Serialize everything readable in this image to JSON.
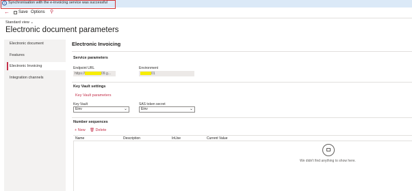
{
  "notification": {
    "message": "Synchronisation with the e-invoicing service was successful"
  },
  "toolbar": {
    "save_label": "Save",
    "options_label": "Options"
  },
  "page": {
    "view_label": "Standard view",
    "title": "Electronic document parameters"
  },
  "nav": {
    "items": [
      {
        "label": "Electronic document"
      },
      {
        "label": "Features"
      },
      {
        "label": "Electronic Invoicing",
        "active": true
      },
      {
        "label": "Integration channels"
      }
    ]
  },
  "content": {
    "title": "Electronic Invoicing",
    "service_parameters": {
      "heading": "Service parameters",
      "endpoint_label": "Endpoint URL",
      "endpoint_prefix": "https://",
      "endpoint_suffix": "09.g...",
      "environment_label": "Environment",
      "environment_suffix": "01"
    },
    "key_vault": {
      "heading": "Key Vault settings",
      "link": "Key Vault parameters",
      "key_vault_label": "Key Vault",
      "key_vault_value": "Einv",
      "sas_label": "SAS token secret",
      "sas_value": "Einv"
    },
    "number_sequences": {
      "heading": "Number sequences",
      "new_label": "New",
      "delete_label": "Delete",
      "columns": [
        "Name",
        "Description",
        "InUse",
        "Current Value"
      ],
      "empty_message": "We didn't find anything to show here."
    }
  },
  "colors": {
    "accent": "#c4314b",
    "notice_bg": "#dbe9f7",
    "masked_highlight": "#f7ed06"
  }
}
